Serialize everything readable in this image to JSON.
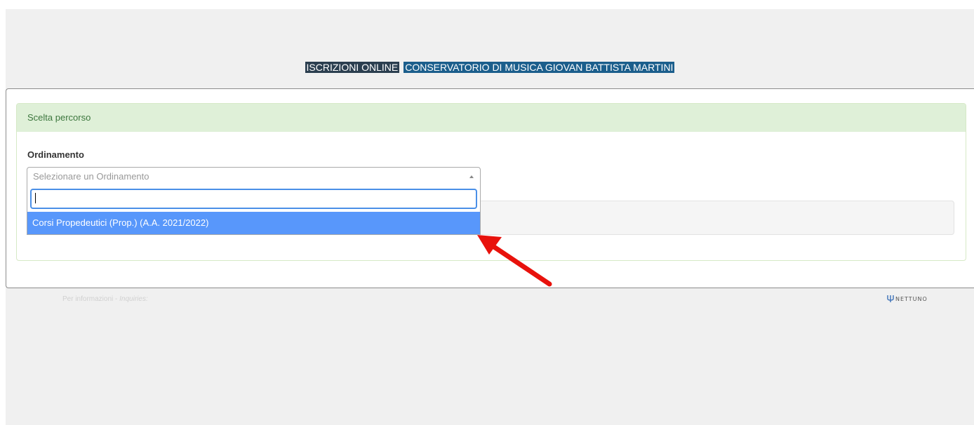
{
  "header": {
    "tag_primary": "ISCRIZIONI ONLINE",
    "tag_institution": "CONSERVATORIO DI MUSICA GIOVAN BATTISTA MARTINI"
  },
  "panel": {
    "title": "Scelta percorso",
    "field_label": "Ordinamento",
    "select_placeholder": "Selezionare un Ordinamento",
    "search_value": "",
    "options": [
      "Corsi Propedeutici (Prop.) (A.A. 2021/2022)"
    ]
  },
  "footer": {
    "info_text": "Per informazioni - ",
    "info_italic": "Inquiries:",
    "logo_text": "NETTUNO"
  },
  "colors": {
    "accent_option": "#5897fb",
    "annotation_arrow": "#e8120c",
    "header_dark": "#2b3e4f",
    "header_blue": "#1b5e8c",
    "panel_heading": "#dff0d8"
  },
  "icons": {
    "select_arrow": "triangle-up-icon",
    "logo": "trident-icon",
    "annotation": "red-arrow-icon"
  }
}
